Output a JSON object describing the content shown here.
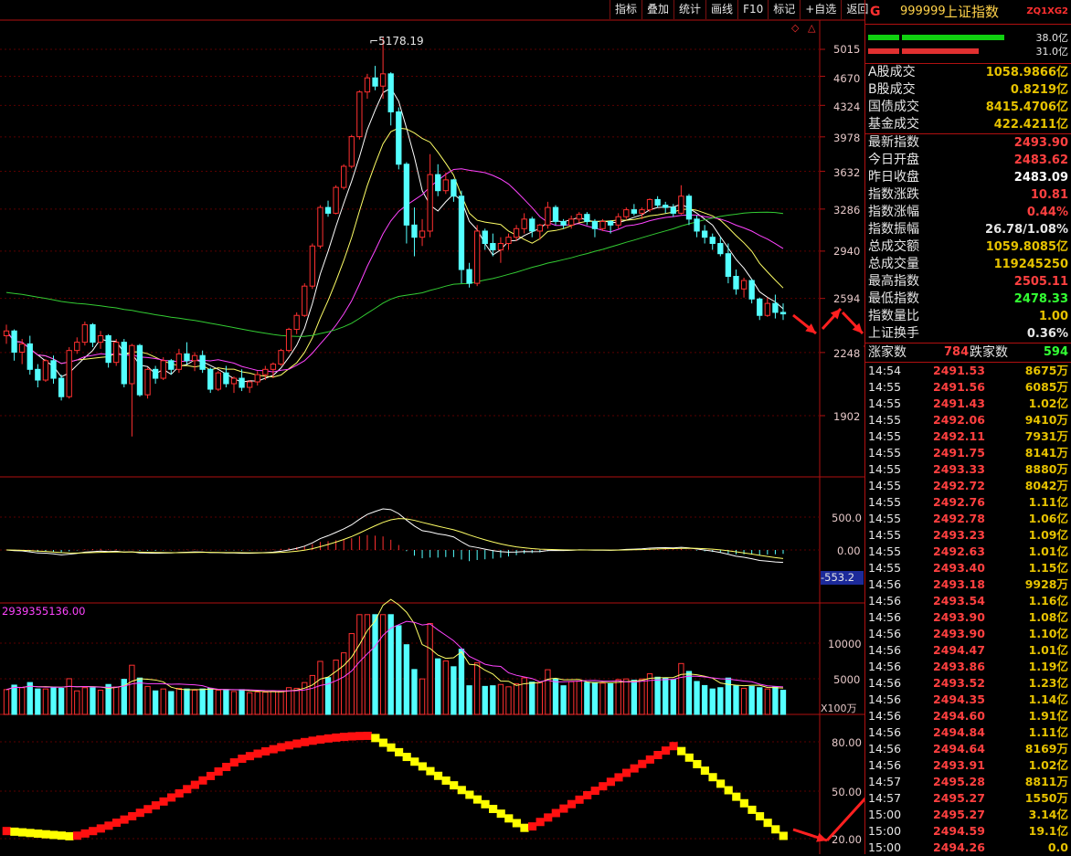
{
  "toolbar": {
    "buttons": [
      "指标",
      "叠加",
      "统计",
      "画线",
      "F10",
      "标记",
      "+自选",
      "返回"
    ]
  },
  "main_chart": {
    "peak_label": "5178.19",
    "y_ticks": [
      "5015",
      "4670",
      "4324",
      "3978",
      "3632",
      "3286",
      "2940",
      "2594",
      "2248",
      "1902"
    ]
  },
  "macd_panel": {
    "y_ticks": [
      "500.0",
      "0.00"
    ],
    "current_value": "-553.2"
  },
  "volume_panel": {
    "header_value": "2939355136.00",
    "y_ticks": [
      "10000",
      "5000"
    ],
    "unit": "X100万"
  },
  "oscillator_panel": {
    "y_ticks": [
      "80.00",
      "50.00",
      "20.00"
    ]
  },
  "quote": {
    "g_mark": "G",
    "code": "999999",
    "name": "上证指数",
    "tag": "ZQ1XG2",
    "bar_green_value": "38.0亿",
    "bar_red_value": "31.0亿",
    "turnover": [
      {
        "label": "A股成交",
        "value": "1058.9866亿"
      },
      {
        "label": "B股成交",
        "value": "0.8219亿"
      },
      {
        "label": "国债成交",
        "value": "8415.4706亿"
      },
      {
        "label": "基金成交",
        "value": "422.4211亿"
      }
    ],
    "stats": [
      {
        "label": "最新指数",
        "value": "2493.90",
        "color": "#ff4040"
      },
      {
        "label": "今日开盘",
        "value": "2483.62",
        "color": "#ff4040"
      },
      {
        "label": "昨日收盘",
        "value": "2483.09",
        "color": "#ffffff"
      },
      {
        "label": "指数涨跌",
        "value": "10.81",
        "color": "#ff4040"
      },
      {
        "label": "指数涨幅",
        "value": "0.44%",
        "color": "#ff4040"
      },
      {
        "label": "指数振幅",
        "value": "26.78/1.08%",
        "color": "#e6e6e6"
      },
      {
        "label": "总成交额",
        "value": "1059.8085亿",
        "color": "#e6c200"
      },
      {
        "label": "总成交量",
        "value": "119245250",
        "color": "#e6c200"
      },
      {
        "label": "最高指数",
        "value": "2505.11",
        "color": "#ff4040"
      },
      {
        "label": "最低指数",
        "value": "2478.33",
        "color": "#33ff33"
      },
      {
        "label": "指数量比",
        "value": "1.00",
        "color": "#e6c200"
      },
      {
        "label": "上证换手",
        "value": "0.36%",
        "color": "#e6e6e6"
      }
    ],
    "advance_label": "涨家数",
    "advance_value": "784",
    "decline_label": "跌家数",
    "decline_value": "594"
  },
  "ticks": [
    {
      "time": "14:54",
      "price": "2491.53",
      "vol": "8675万"
    },
    {
      "time": "14:55",
      "price": "2491.56",
      "vol": "6085万"
    },
    {
      "time": "14:55",
      "price": "2491.43",
      "vol": "1.02亿"
    },
    {
      "time": "14:55",
      "price": "2492.06",
      "vol": "9410万"
    },
    {
      "time": "14:55",
      "price": "2492.11",
      "vol": "7931万"
    },
    {
      "time": "14:55",
      "price": "2491.75",
      "vol": "8141万"
    },
    {
      "time": "14:55",
      "price": "2493.33",
      "vol": "8880万"
    },
    {
      "time": "14:55",
      "price": "2492.72",
      "vol": "8042万"
    },
    {
      "time": "14:55",
      "price": "2492.76",
      "vol": "1.11亿"
    },
    {
      "time": "14:55",
      "price": "2492.78",
      "vol": "1.06亿"
    },
    {
      "time": "14:55",
      "price": "2493.23",
      "vol": "1.09亿"
    },
    {
      "time": "14:55",
      "price": "2492.63",
      "vol": "1.01亿"
    },
    {
      "time": "14:55",
      "price": "2493.40",
      "vol": "1.15亿"
    },
    {
      "time": "14:56",
      "price": "2493.18",
      "vol": "9928万"
    },
    {
      "time": "14:56",
      "price": "2493.54",
      "vol": "1.16亿"
    },
    {
      "time": "14:56",
      "price": "2493.90",
      "vol": "1.08亿"
    },
    {
      "time": "14:56",
      "price": "2493.90",
      "vol": "1.10亿"
    },
    {
      "time": "14:56",
      "price": "2494.47",
      "vol": "1.01亿"
    },
    {
      "time": "14:56",
      "price": "2493.86",
      "vol": "1.19亿"
    },
    {
      "time": "14:56",
      "price": "2493.52",
      "vol": "1.23亿"
    },
    {
      "time": "14:56",
      "price": "2494.35",
      "vol": "1.14亿"
    },
    {
      "time": "14:56",
      "price": "2494.60",
      "vol": "1.91亿"
    },
    {
      "time": "14:56",
      "price": "2494.84",
      "vol": "1.11亿"
    },
    {
      "time": "14:56",
      "price": "2494.64",
      "vol": "8169万"
    },
    {
      "time": "14:56",
      "price": "2493.91",
      "vol": "1.02亿"
    },
    {
      "time": "14:57",
      "price": "2495.28",
      "vol": "8811万"
    },
    {
      "time": "14:57",
      "price": "2495.27",
      "vol": "1550万"
    },
    {
      "time": "15:00",
      "price": "2495.27",
      "vol": "3.14亿"
    },
    {
      "time": "15:00",
      "price": "2494.59",
      "vol": "19.1亿"
    },
    {
      "time": "15:00",
      "price": "2494.26",
      "vol": "0.0"
    }
  ],
  "colors": {
    "up": "#ff3030",
    "down": "#54ffff",
    "ma5": "#ffffff",
    "ma10": "#ffff66",
    "ma20": "#ff44ff",
    "ma60": "#33cc33",
    "osc_up": "#ff1010",
    "osc_down": "#ffff00",
    "arrow": "#ff2020"
  },
  "chart_data": {
    "type": "candlestick",
    "price_axis_ticks": [
      5015,
      4670,
      4324,
      3978,
      3632,
      3286,
      2940,
      2594,
      2248,
      1902
    ],
    "peak": 5178.19,
    "candles": [
      [
        2350,
        2420,
        2300,
        2380
      ],
      [
        2380,
        2390,
        2200,
        2250
      ],
      [
        2250,
        2330,
        2180,
        2300
      ],
      [
        2300,
        2350,
        2120,
        2150
      ],
      [
        2150,
        2180,
        2050,
        2090
      ],
      [
        2090,
        2210,
        2080,
        2200
      ],
      [
        2200,
        2230,
        2070,
        2100
      ],
      [
        2100,
        2120,
        1980,
        2000
      ],
      [
        2000,
        2280,
        1990,
        2260
      ],
      [
        2260,
        2340,
        2240,
        2310
      ],
      [
        2310,
        2440,
        2290,
        2420
      ],
      [
        2420,
        2430,
        2280,
        2310
      ],
      [
        2310,
        2380,
        2270,
        2350
      ],
      [
        2350,
        2360,
        2160,
        2190
      ],
      [
        2190,
        2330,
        2170,
        2310
      ],
      [
        2310,
        2330,
        2050,
        2070
      ],
      [
        2070,
        2300,
        1800,
        2290
      ],
      [
        2290,
        2300,
        2000,
        2010
      ],
      [
        2010,
        2160,
        1990,
        2150
      ],
      [
        2150,
        2170,
        2070,
        2100
      ],
      [
        2100,
        2220,
        2090,
        2200
      ],
      [
        2200,
        2210,
        2120,
        2150
      ],
      [
        2150,
        2270,
        2130,
        2240
      ],
      [
        2240,
        2310,
        2180,
        2200
      ],
      [
        2200,
        2250,
        2140,
        2230
      ],
      [
        2230,
        2260,
        2130,
        2150
      ],
      [
        2150,
        2160,
        2020,
        2040
      ],
      [
        2040,
        2140,
        2030,
        2130
      ],
      [
        2130,
        2170,
        2050,
        2070
      ],
      [
        2070,
        2110,
        2020,
        2100
      ],
      [
        2100,
        2150,
        2030,
        2050
      ],
      [
        2050,
        2090,
        2020,
        2080
      ],
      [
        2080,
        2140,
        2060,
        2120
      ],
      [
        2120,
        2170,
        2090,
        2150
      ],
      [
        2150,
        2190,
        2100,
        2180
      ],
      [
        2180,
        2270,
        2170,
        2260
      ],
      [
        2260,
        2400,
        2250,
        2390
      ],
      [
        2390,
        2500,
        2360,
        2480
      ],
      [
        2480,
        2700,
        2470,
        2680
      ],
      [
        2680,
        3000,
        2660,
        2980
      ],
      [
        2980,
        3320,
        2960,
        3300
      ],
      [
        3300,
        3360,
        3220,
        3250
      ],
      [
        3250,
        3500,
        3240,
        3480
      ],
      [
        3480,
        3700,
        3460,
        3680
      ],
      [
        3680,
        4000,
        3660,
        3980
      ],
      [
        3980,
        4500,
        3950,
        4480
      ],
      [
        4480,
        4700,
        4400,
        4650
      ],
      [
        4650,
        4800,
        4500,
        4550
      ],
      [
        4550,
        5178,
        4400,
        4700
      ],
      [
        4700,
        4720,
        4100,
        4250
      ],
      [
        4250,
        4300,
        3650,
        3700
      ],
      [
        3700,
        3720,
        3000,
        3150
      ],
      [
        3150,
        3300,
        2900,
        3050
      ],
      [
        3050,
        3200,
        2980,
        3100
      ],
      [
        3100,
        3800,
        3050,
        3600
      ],
      [
        3600,
        3700,
        3400,
        3450
      ],
      [
        3450,
        3620,
        3420,
        3550
      ],
      [
        3550,
        3560,
        3350,
        3400
      ],
      [
        3400,
        3450,
        2700,
        2800
      ],
      [
        2800,
        2850,
        2670,
        2700
      ],
      [
        2700,
        3150,
        2680,
        3100
      ],
      [
        3100,
        3120,
        2950,
        3000
      ],
      [
        3000,
        3080,
        2900,
        2950
      ],
      [
        2950,
        3050,
        2850,
        3000
      ],
      [
        3000,
        3080,
        2950,
        3050
      ],
      [
        3050,
        3150,
        3020,
        3120
      ],
      [
        3120,
        3250,
        3080,
        3200
      ],
      [
        3200,
        3220,
        3050,
        3100
      ],
      [
        3100,
        3160,
        3030,
        3150
      ],
      [
        3150,
        3350,
        3120,
        3300
      ],
      [
        3300,
        3320,
        3150,
        3180
      ],
      [
        3180,
        3200,
        3120,
        3150
      ],
      [
        3150,
        3230,
        3120,
        3200
      ],
      [
        3200,
        3260,
        3170,
        3240
      ],
      [
        3240,
        3260,
        3150,
        3180
      ],
      [
        3180,
        3200,
        3050,
        3120
      ],
      [
        3120,
        3200,
        3100,
        3180
      ],
      [
        3180,
        3190,
        3080,
        3150
      ],
      [
        3150,
        3250,
        3120,
        3220
      ],
      [
        3220,
        3300,
        3200,
        3280
      ],
      [
        3280,
        3330,
        3230,
        3250
      ],
      [
        3250,
        3300,
        3200,
        3280
      ],
      [
        3280,
        3380,
        3260,
        3370
      ],
      [
        3370,
        3400,
        3300,
        3320
      ],
      [
        3320,
        3350,
        3250,
        3300
      ],
      [
        3300,
        3330,
        3220,
        3250
      ],
      [
        3250,
        3500,
        3240,
        3400
      ],
      [
        3400,
        3420,
        3150,
        3200
      ],
      [
        3200,
        3230,
        3050,
        3100
      ],
      [
        3100,
        3150,
        3000,
        3050
      ],
      [
        3050,
        3080,
        2950,
        3000
      ],
      [
        3000,
        3050,
        2900,
        2920
      ],
      [
        2920,
        3000,
        2700,
        2750
      ],
      [
        2750,
        2800,
        2620,
        2660
      ],
      [
        2660,
        2740,
        2600,
        2720
      ],
      [
        2720,
        2730,
        2560,
        2590
      ],
      [
        2590,
        2600,
        2450,
        2480
      ],
      [
        2480,
        2600,
        2470,
        2560
      ],
      [
        2560,
        2620,
        2460,
        2500
      ],
      [
        2500,
        2560,
        2450,
        2490
      ]
    ]
  }
}
